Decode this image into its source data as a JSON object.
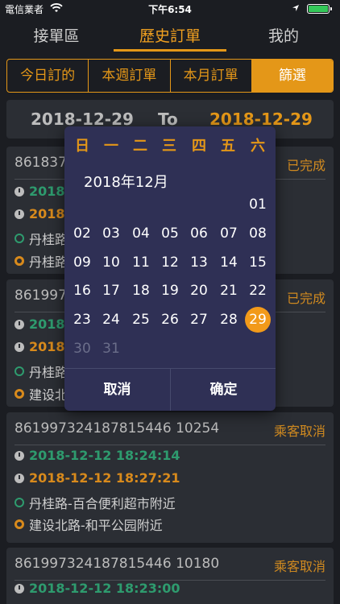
{
  "status": {
    "carrier": "電信業者",
    "time": "下午6:54"
  },
  "nav": {
    "tabs": [
      "接單區",
      "歷史訂單",
      "我的"
    ]
  },
  "segments": [
    "今日訂的",
    "本週訂單",
    "本月訂單",
    "篩選"
  ],
  "range": {
    "from": "2018-12-29",
    "to": "To",
    "end": "2018-12-29"
  },
  "orders": [
    {
      "id": "861837",
      "status": "已完成",
      "start_time": "2018",
      "end_time": "2018",
      "from": "丹桂路",
      "to": "丹桂路"
    },
    {
      "id": "861997",
      "status": "已完成",
      "start_time": "2018",
      "end_time": "2018",
      "from": "丹桂路",
      "to": "建设北"
    },
    {
      "id": "861997324187815446 10254",
      "status": "乘客取消",
      "start_time": "2018-12-12 18:24:14",
      "end_time": "2018-12-12 18:27:21",
      "from": "丹桂路-百合便利超市附近",
      "to": "建设北路-和平公园附近"
    },
    {
      "id": "861997324187815446 10180",
      "status": "乘客取消",
      "start_time": "2018-12-12 18:23:00",
      "end_time": "",
      "from": "",
      "to": ""
    }
  ],
  "calendar": {
    "weekdays": [
      "日",
      "一",
      "二",
      "三",
      "四",
      "五",
      "六"
    ],
    "month_label": "2018年12月",
    "days": [
      "01",
      "02",
      "03",
      "04",
      "05",
      "06",
      "07",
      "08",
      "09",
      "10",
      "11",
      "12",
      "13",
      "14",
      "15",
      "16",
      "17",
      "18",
      "19",
      "20",
      "21",
      "22",
      "23",
      "24",
      "25",
      "26",
      "27",
      "28",
      "29",
      "30",
      "31"
    ],
    "selected": "29",
    "cancel": "取消",
    "confirm": "确定"
  },
  "colors": {
    "accent": "#e49718",
    "green": "#2e9b6e",
    "modal_bg": "#2f3055"
  }
}
